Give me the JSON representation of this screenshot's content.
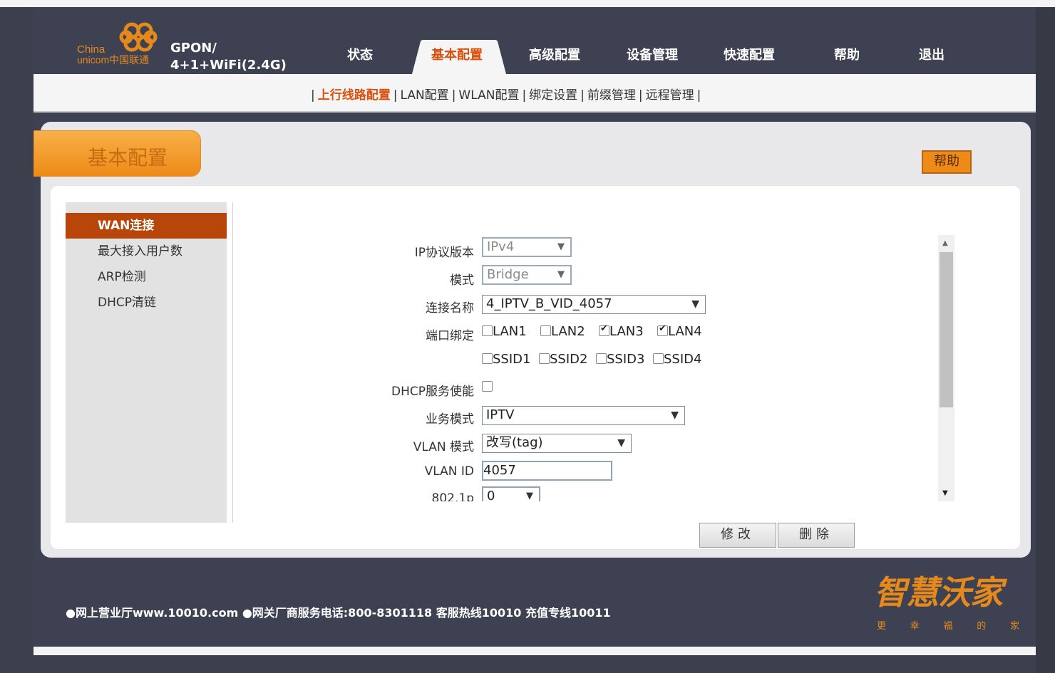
{
  "header": {
    "logo_line1": "China",
    "logo_line2": "unicom中国联通",
    "product_line1": "GPON/",
    "product_line2": "4+1+WiFi(2.4G)",
    "nav": [
      "状态",
      "基本配置",
      "高级配置",
      "设备管理",
      "快速配置",
      "帮助",
      "退出"
    ],
    "active_nav": "基本配置"
  },
  "subnav": {
    "items": [
      "上行线路配置",
      "LAN配置",
      "WLAN配置",
      "绑定设置",
      "前缀管理",
      "远程管理"
    ]
  },
  "page": {
    "title": "基本配置",
    "help_label": "帮助"
  },
  "sidebar": {
    "items": [
      "WAN连接",
      "最大接入用户数",
      "ARP检测",
      "DHCP清链"
    ]
  },
  "form": {
    "ip_version": {
      "label": "IP协议版本",
      "value": "IPv4"
    },
    "mode": {
      "label": "模式",
      "value": "Bridge"
    },
    "connection_name": {
      "label": "连接名称",
      "value": "4_IPTV_B_VID_4057"
    },
    "port_binding": {
      "label": "端口绑定",
      "ports": [
        {
          "name": "LAN1",
          "checked": false
        },
        {
          "name": "LAN2",
          "checked": false
        },
        {
          "name": "LAN3",
          "checked": true
        },
        {
          "name": "LAN4",
          "checked": true
        },
        {
          "name": "SSID1",
          "checked": false
        },
        {
          "name": "SSID2",
          "checked": false
        },
        {
          "name": "SSID3",
          "checked": false
        },
        {
          "name": "SSID4",
          "checked": false
        }
      ]
    },
    "dhcp_enable": {
      "label": "DHCP服务使能",
      "checked": false
    },
    "service_mode": {
      "label": "业务模式",
      "value": "IPTV"
    },
    "vlan_mode": {
      "label": "VLAN 模式",
      "value": "改写(tag)"
    },
    "vlan_id": {
      "label": "VLAN ID",
      "value": "4057"
    },
    "priority": {
      "label": "802.1p",
      "value": "0"
    }
  },
  "actions": {
    "modify": "修改",
    "delete": "删除"
  },
  "footer": {
    "text": "●网上营业厅www.10010.com ●网关厂商服务电话:800-8301118 客服热线10010 充值专线10011",
    "brand": "智慧沃家",
    "brand_sub": [
      "更",
      "幸",
      "福",
      "的",
      "家"
    ]
  },
  "colors": {
    "accent": "#d9500e",
    "brand_orange": "#ee8a18",
    "frame_dark": "#3d4152"
  }
}
